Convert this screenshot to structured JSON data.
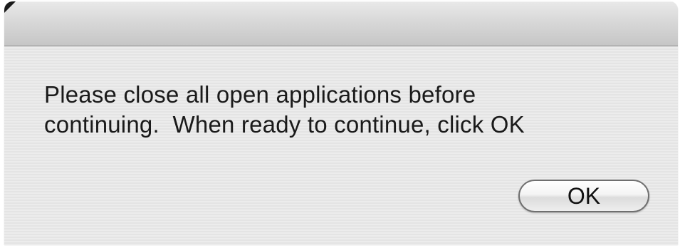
{
  "dialog": {
    "message_line1": "Please close all open applications before",
    "message_line2": "continuing.  When ready to continue, click OK",
    "ok_label": "OK"
  },
  "colors": {
    "titlebar": "#d8d8d8",
    "body_stripe_light": "#ececec",
    "body_stripe_dark": "#e4e4e4",
    "text": "#1a1a1a",
    "button_border": "#6f6f6f"
  }
}
